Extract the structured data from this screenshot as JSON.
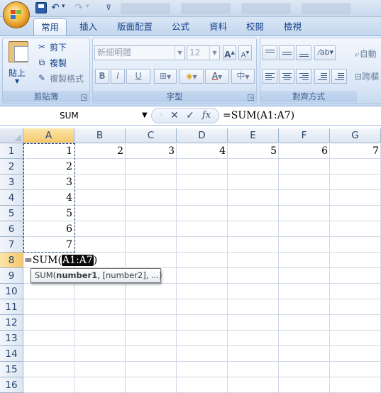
{
  "quick_access": {
    "save_icon": "save-icon",
    "undo_icon": "undo-icon",
    "undo_symbol": "↶",
    "redo_symbol": "↷",
    "dropdown_symbol": "▾",
    "customize_symbol": "⊽"
  },
  "ribbon": {
    "tabs": [
      {
        "label": "常用",
        "active": true
      },
      {
        "label": "插入",
        "active": false
      },
      {
        "label": "版面配置",
        "active": false
      },
      {
        "label": "公式",
        "active": false
      },
      {
        "label": "資料",
        "active": false
      },
      {
        "label": "校閱",
        "active": false
      },
      {
        "label": "檢視",
        "active": false
      }
    ],
    "clipboard": {
      "paste_label": "貼上",
      "cut_label": "剪下",
      "copy_label": "複製",
      "format_painter_label": "複製格式",
      "group_label": "剪貼簿"
    },
    "font": {
      "font_name": "新細明體",
      "font_size": "12",
      "grow_label": "A",
      "shrink_label": "A",
      "bold": "B",
      "italic": "I",
      "underline": "U",
      "phonetic": "中",
      "group_label": "字型"
    },
    "alignment": {
      "wrap_text_label": "自動",
      "merge_label": "跨欄",
      "group_label": "對齊方式"
    }
  },
  "formula_bar": {
    "name_box": "SUM",
    "cancel_symbol": "✕",
    "enter_symbol": "✓",
    "fx_symbol": "fx",
    "formula": "=SUM(A1:A7)"
  },
  "sheet": {
    "columns": [
      "A",
      "B",
      "C",
      "D",
      "E",
      "F",
      "G"
    ],
    "rows": [
      "1",
      "2",
      "3",
      "4",
      "5",
      "6",
      "7",
      "8",
      "9",
      "10",
      "11",
      "12",
      "13",
      "14",
      "15",
      "16"
    ],
    "cells": {
      "A1": "1",
      "B1": "2",
      "C1": "3",
      "D1": "4",
      "E1": "5",
      "F1": "6",
      "G1": "7",
      "A2": "2",
      "A3": "3",
      "A4": "4",
      "A5": "5",
      "A6": "6",
      "A7": "7"
    },
    "active_cell": "A8",
    "edit_text": {
      "prefix": "=SUM(",
      "range": "A1:A7",
      "suffix": ")"
    },
    "tooltip": {
      "fn": "SUM(",
      "arg1": "number1",
      "rest": ", [number2], ...)"
    }
  },
  "colors": {
    "selected_header": "#f6c76c",
    "marquee": "#1f3b78",
    "ribbon_text": "#15428b"
  }
}
